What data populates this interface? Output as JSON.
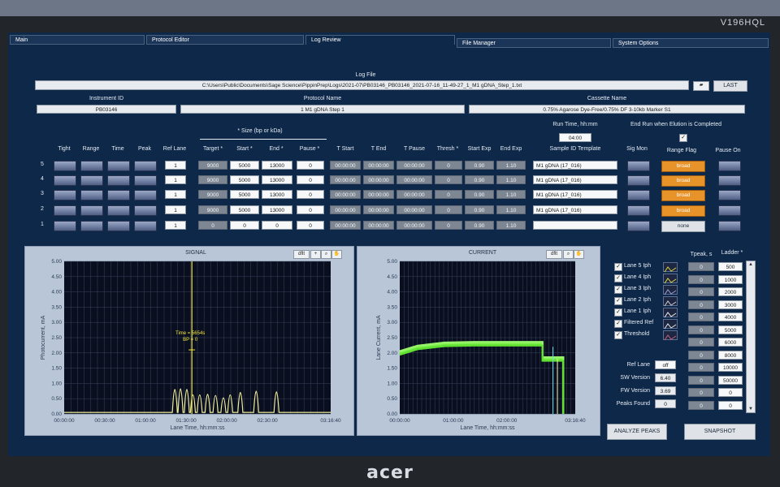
{
  "monitor": {
    "model": "V196HQL",
    "brand": "acer"
  },
  "tabs": [
    "Main",
    "Protocol Editor",
    "Log Review",
    "File Manager",
    "System Options"
  ],
  "log_file": {
    "label": "Log File",
    "path": "C:\\Users\\Public\\Documents\\Sage Science\\PippinPrep\\Logs\\2021-07\\PB03146_PB03146_2021-07-16_11-49-27_1_M1 gDNA_Step_1.txt",
    "last_label": "LAST"
  },
  "info": {
    "instrument_label": "Instrument ID",
    "instrument_value": "PB03146",
    "protocol_label": "Protocol Name",
    "protocol_value": "1 M1 gDNA Step 1",
    "cassette_label": "Cassette Name",
    "cassette_value": "0.75% Agarose Dye-Free/0.75% DF 3-10kb Marker S1"
  },
  "runtime": {
    "label": "Run Time, hh:mm",
    "value": "04:00"
  },
  "end_run": {
    "label": "End Run when Elution is Completed",
    "checked": "✓"
  },
  "size_header": "* Size (bp or kDa)",
  "columns": {
    "tight": "Tight",
    "range": "Range",
    "time": "Time",
    "peak": "Peak",
    "ref_lane": "Ref Lane",
    "target": "Target *",
    "start": "Start *",
    "end": "End *",
    "pause": "Pause *",
    "t_start": "T Start",
    "t_end": "T End",
    "t_pause": "T Pause",
    "thresh": "Thresh *",
    "start_exp": "Start Exp",
    "end_exp": "End Exp",
    "sample_id": "Sample ID Template",
    "sig_mon": "Sig Mon",
    "range_flag": "Range Flag",
    "pause_on": "Pause On"
  },
  "lanes": [
    {
      "num": "5",
      "ref": "1",
      "target": "9000",
      "start": "5000",
      "end": "13000",
      "pause": "0",
      "t_start": "00:00:00",
      "t_end": "00:00:00",
      "t_pause": "00:00:00",
      "thresh": "0",
      "start_exp": "0.90",
      "end_exp": "1.10",
      "sample": "M1 gDNA (17_016)",
      "flag": "broad"
    },
    {
      "num": "4",
      "ref": "1",
      "target": "9000",
      "start": "5000",
      "end": "13000",
      "pause": "0",
      "t_start": "00:00:00",
      "t_end": "00:00:00",
      "t_pause": "00:00:00",
      "thresh": "0",
      "start_exp": "0.90",
      "end_exp": "1.10",
      "sample": "M1 gDNA (17_016)",
      "flag": "broad"
    },
    {
      "num": "3",
      "ref": "1",
      "target": "9000",
      "start": "5000",
      "end": "13000",
      "pause": "0",
      "t_start": "00:00:00",
      "t_end": "00:00:00",
      "t_pause": "00:00:00",
      "thresh": "0",
      "start_exp": "0.90",
      "end_exp": "1.10",
      "sample": "M1 gDNA (17_016)",
      "flag": "broad"
    },
    {
      "num": "2",
      "ref": "1",
      "target": "9000",
      "start": "5000",
      "end": "13000",
      "pause": "0",
      "t_start": "00:00:00",
      "t_end": "00:00:00",
      "t_pause": "00:00:00",
      "thresh": "0",
      "start_exp": "0.90",
      "end_exp": "1.10",
      "sample": "M1 gDNA (17_016)",
      "flag": "broad"
    },
    {
      "num": "1",
      "ref": "1",
      "target": "0",
      "start": "0",
      "end": "0",
      "pause": "0",
      "t_start": "00:00:00",
      "t_end": "00:00:00",
      "t_pause": "00:00:00",
      "thresh": "0",
      "start_exp": "0.90",
      "end_exp": "1.10",
      "sample": "",
      "flag": "none"
    }
  ],
  "legend": {
    "items": [
      "Lane 5 Iph",
      "Lane 4 Iph",
      "Lane 3 Iph",
      "Lane 2 Iph",
      "Lane 1 Iph",
      "Filtered Ref",
      "Threshold"
    ],
    "checked": "✓"
  },
  "status": {
    "ref_lane_label": "Ref Lane",
    "ref_lane_value": "off",
    "sw_label": "SW Version",
    "sw_value": "6.40",
    "fw_label": "FW Version",
    "fw_value": "3.69",
    "peaks_label": "Peaks Found",
    "peaks_value": "0"
  },
  "tpeak": {
    "label": "Tpeak, s",
    "values": [
      "0",
      "0",
      "0",
      "0",
      "0",
      "0",
      "0",
      "0",
      "0",
      "0",
      "0",
      "0"
    ]
  },
  "ladder": {
    "label": "Ladder *",
    "values": [
      "500",
      "1000",
      "2000",
      "3000",
      "4000",
      "5000",
      "6000",
      "8000",
      "10000",
      "50000",
      "0",
      "0"
    ]
  },
  "buttons": {
    "analyze": "ANALYZE PEAKS",
    "snapshot": "SNAPSHOT"
  },
  "plot_controls": {
    "dflt": "dflt"
  },
  "chart_data": [
    {
      "type": "line",
      "title": "SIGNAL",
      "xlabel": "Lane Time, hh:mm:ss",
      "ylabel": "Photocurrent, mA",
      "ylim": [
        0,
        5
      ],
      "xlim": [
        0,
        11800
      ],
      "x_ticks": [
        "00:00:00",
        "00:30:00",
        "01:00:00",
        "01:30:00",
        "02:00:00",
        "02:30:00",
        "03:16:40"
      ],
      "x_tick_values": [
        0,
        1800,
        3600,
        5400,
        7200,
        9000,
        11800
      ],
      "y_ticks": [
        "0.00",
        "0.50",
        "1.00",
        "1.50",
        "2.00",
        "2.50",
        "3.00",
        "3.50",
        "4.00",
        "4.50",
        "5.00"
      ],
      "cursor": {
        "x": 5654,
        "label_time": "Time = 5654s",
        "label_bp": "BP = 0"
      },
      "series": [
        {
          "peaks_x": [
            4900,
            5150,
            5430,
            5700,
            6000,
            6350,
            6700,
            7050,
            7350,
            7800,
            8500,
            9400
          ],
          "peaks_y": [
            0.78,
            0.8,
            0.78,
            0.6,
            0.6,
            0.62,
            0.58,
            0.5,
            0.6,
            0.68,
            0.72,
            0.7
          ]
        }
      ],
      "grid": true
    },
    {
      "type": "line",
      "title": "CURRENT",
      "xlabel": "Lane Time, hh:mm:ss",
      "ylabel": "Lane Current, mA",
      "ylim": [
        0,
        5
      ],
      "xlim": [
        0,
        11800
      ],
      "x_ticks": [
        "00:00:00",
        "01:00:00",
        "02:00:00",
        "03:16:40"
      ],
      "x_tick_values": [
        0,
        3600,
        7200,
        11800
      ],
      "y_ticks": [
        "0.00",
        "0.50",
        "1.00",
        "1.50",
        "2.00",
        "2.50",
        "3.00",
        "3.50",
        "4.00",
        "4.50",
        "5.00"
      ],
      "series": [
        {
          "x": [
            0,
            1200,
            3000,
            5000,
            7200,
            9000,
            9600,
            9600,
            11000,
            11000
          ],
          "y": [
            2.0,
            2.18,
            2.28,
            2.3,
            2.3,
            2.3,
            2.3,
            1.8,
            1.8,
            0.0
          ]
        }
      ],
      "grid": true
    }
  ]
}
